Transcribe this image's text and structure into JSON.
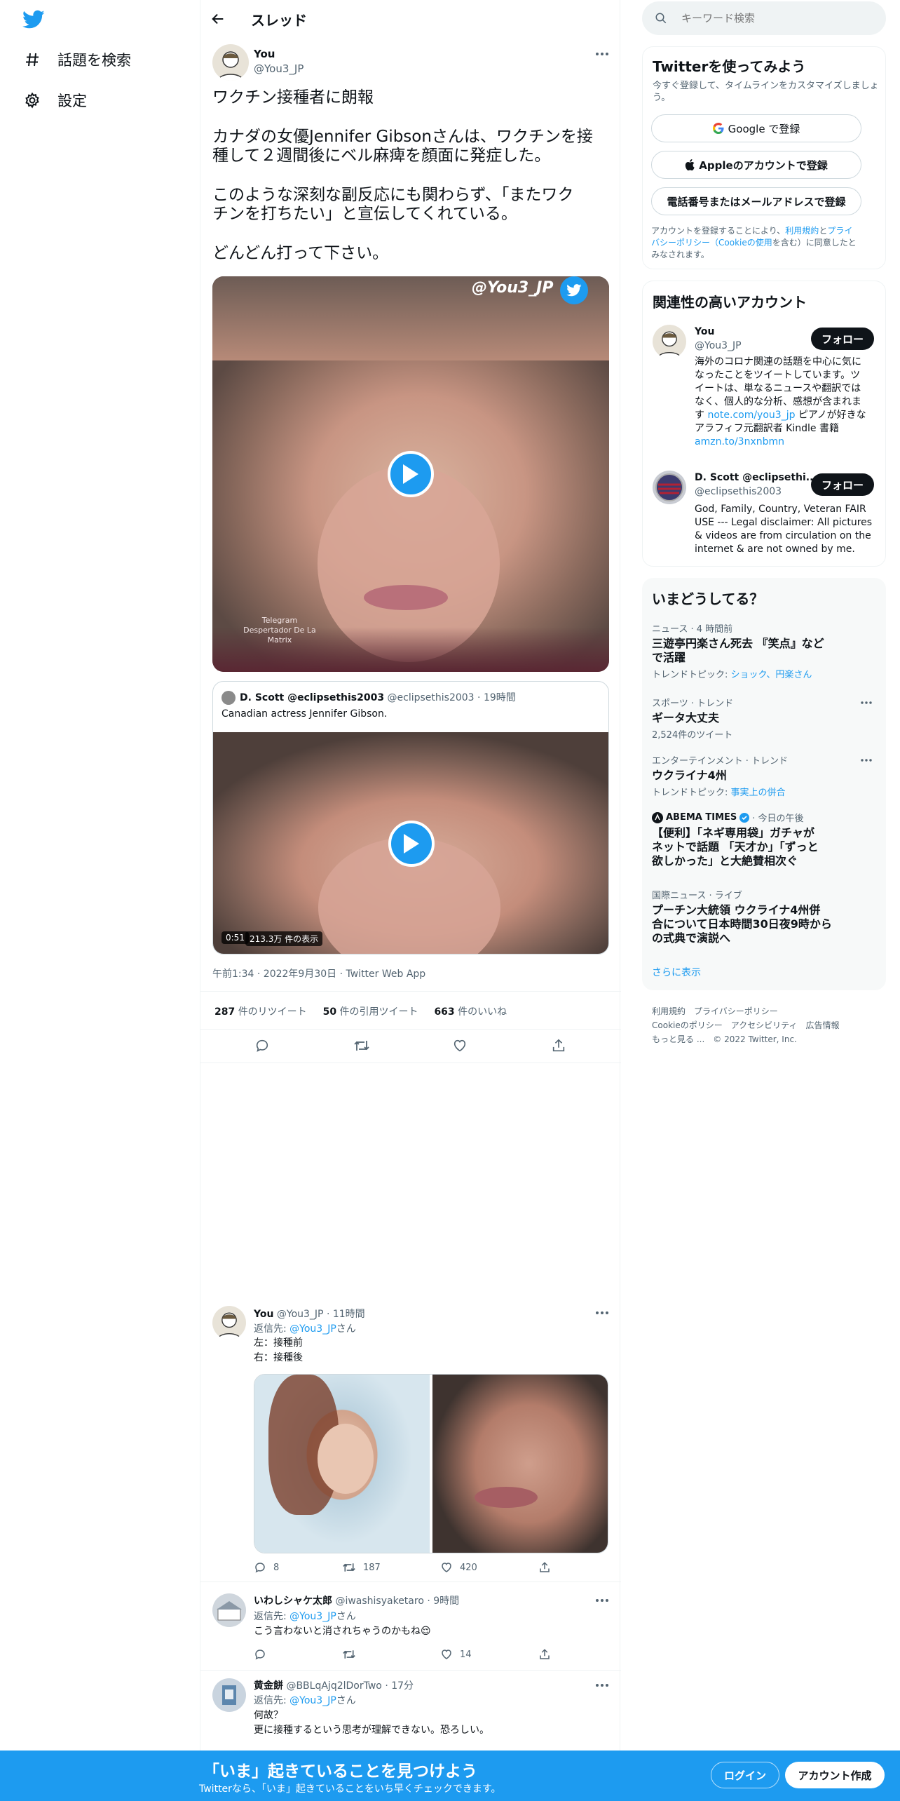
{
  "nav": {
    "explore_label": "話題を検索",
    "settings_label": "設定"
  },
  "header": {
    "title": "スレッド"
  },
  "tweet": {
    "display_name": "You",
    "handle": "@You3_JP",
    "line1": "ワクチン接種者に朗報",
    "line2": "カナダの女優Jennifer Gibsonさんは、ワクチンを接",
    "line3": "種して２週間後にベル麻痺を顔面に発症した。",
    "line4": "このような深刻な副反応にも関わらず、「またワク",
    "line5": "チンを打ちたい」と宣伝してくれている。",
    "line6": "どんどん打って下さい。",
    "video_watermark": "@You3_JP",
    "video_caption": "Telegram\nDespertador De La\nMatrix",
    "timestamp": "午前1:34 · 2022年9月30日 · Twitter Web App",
    "retweets": "287",
    "retweets_label": "件のリツイート",
    "quotes": "50",
    "quotes_label": "件の引用ツイート",
    "likes": "663",
    "likes_label": "件のいいね"
  },
  "quote": {
    "display_name": "D. Scott @eclipsethis2003",
    "handle": "@eclipsethis2003",
    "time": "· 19時間",
    "text": "Canadian actress Jennifer Gibson.",
    "duration": "0:51",
    "views": "213.3万 件の表示"
  },
  "replies": [
    {
      "display_name": "You",
      "handle": "@You3_JP",
      "time": "· 11時間",
      "reply_prefix": "返信先: ",
      "reply_to": "@You3_JP",
      "reply_suffix": "さん",
      "text1": "左：接種前",
      "text2": "右：接種後",
      "replies_count": "8",
      "retweets_count": "187",
      "likes_count": "420"
    },
    {
      "display_name": "いわしシャケ太郎",
      "handle": "@iwashisyaketaro",
      "time": "· 9時間",
      "reply_prefix": "返信先: ",
      "reply_to": "@You3_JP",
      "reply_suffix": "さん",
      "text1": "こう言わないと消されちゃうのかもね😌",
      "likes_count": "14"
    },
    {
      "display_name": "黄金餅",
      "handle": "@BBLqAjq2lDorTwo",
      "time": "· 17分",
      "reply_prefix": "返信先: ",
      "reply_to": "@You3_JP",
      "reply_suffix": "さん",
      "text1": "何故？",
      "text2": "更に接種するという思考が理解できない。恐ろしい。"
    }
  ],
  "search": {
    "placeholder": "キーワード検索"
  },
  "signup": {
    "title": "Twitterを使ってみよう",
    "subtitle1": "今すぐ登録して、タイムラインをカスタマイズしましょ",
    "subtitle2": "う。",
    "google_label": "Google で登録",
    "apple_label": "Appleのアカウントで登録",
    "phone_label": "電話番号またはメールアドレスで登録",
    "legal_a": "アカウントを登録することにより、",
    "legal_terms": "利用規約",
    "legal_and": "と",
    "legal_privacy1": "プライ",
    "legal_privacy2": "バシーポリシー",
    "legal_cookie": "（Cookieの使用",
    "legal_b": "を含む）に同意したと",
    "legal_c": "みなされます。"
  },
  "related": {
    "title": "関連性の高いアカウント",
    "follow_label": "フォロー",
    "accounts": [
      {
        "name": "You",
        "handle": "@You3_JP",
        "bio1": "海外のコロナ関連の話題を中心に気に",
        "bio2": "なったことをツイートしています。ツ",
        "bio3": "イートは、単なるニュースや翻訳では",
        "bio4": "なく、個人的な分析、感想が含まれま",
        "bio5a": "す ",
        "bio5link": "note.com/you3_jp",
        "bio5b": " ピアノが好きな",
        "bio6": "アラフィフ元翻訳者 Kindle 書籍",
        "bio7link": "amzn.to/3nxnbmn"
      },
      {
        "name": "D. Scott @eclipsethi...",
        "handle": "@eclipsethis2003",
        "bio1": "God, Family, Country, Veteran FAIR",
        "bio2": "USE --- Legal disclaimer: All pictures",
        "bio3": "& videos are from circulation on the",
        "bio4": "internet & are not owned by me."
      }
    ]
  },
  "trends": {
    "title": "いまどうしてる？",
    "items": [
      {
        "category": "ニュース · 4 時間前",
        "title1": "三遊亭円楽さん死去 『笑点』など",
        "title2": "で活躍",
        "sub_label": "トレンドトピック: ",
        "sub_link": "ショック、円楽さん"
      },
      {
        "category": "スポーツ · トレンド",
        "title1": "ギータ大丈夫",
        "sub": "2,524件のツイート"
      },
      {
        "category": "エンターテインメント · トレンド",
        "title1": "ウクライナ4州",
        "sub_label": "トレンドトピック: ",
        "sub_link": "事実上の併合"
      },
      {
        "category_source": "ABEMA TIMES",
        "category_time": " · 今日の午後",
        "title1": "【便利】「ネギ専用袋」ガチャが",
        "title2": "ネットで話題 「天才か」「ずっと",
        "title3": "欲しかった」と大絶賛相次ぐ"
      },
      {
        "category": "国際ニュース · ライブ",
        "title1": "プーチン大統領 ウクライナ4州併",
        "title2": "合について日本時間30日夜9時から",
        "title3": "の式典で演説へ"
      }
    ],
    "show_more": "さらに表示"
  },
  "footer": {
    "terms": "利用規約",
    "privacy": "プライバシーポリシー",
    "cookie": "Cookieのポリシー",
    "accessibility": "アクセシビリティ",
    "ads": "広告情報",
    "more": "もっと見る ...",
    "copyright": "© 2022 Twitter, Inc."
  },
  "banner": {
    "title": "「いま」起きていることを見つけよう",
    "subtitle": "Twitterなら、「いま」起きていることをいち早くチェックできます。",
    "login_label": "ログイン",
    "signup_label": "アカウント作成"
  },
  "colors": {
    "accent": "#1d9bf0",
    "text": "#0f1419",
    "muted": "#536471"
  }
}
